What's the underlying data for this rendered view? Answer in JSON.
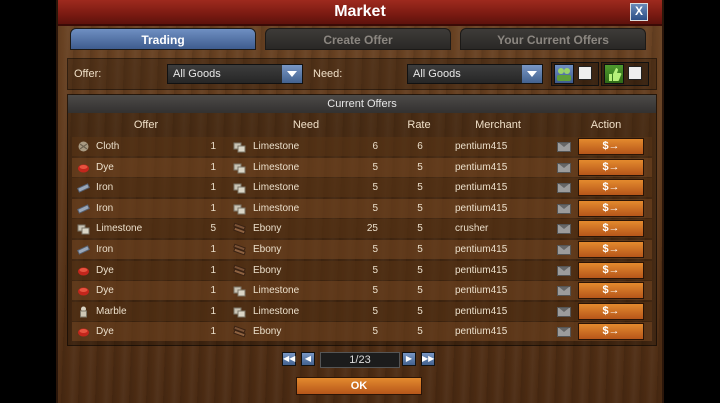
{
  "window": {
    "title": "Market",
    "close_label": "X"
  },
  "tabs": [
    {
      "label": "Trading",
      "active": true
    },
    {
      "label": "Create Offer",
      "active": false
    },
    {
      "label": "Your Current Offers",
      "active": false
    }
  ],
  "filters": {
    "offer_label": "Offer:",
    "offer_value": "All Goods",
    "need_label": "Need:",
    "need_value": "All Goods"
  },
  "offers": {
    "section_title": "Current Offers",
    "columns": [
      "Offer",
      "Need",
      "Rate",
      "Merchant",
      "Action"
    ],
    "rows": [
      {
        "offer_good": "Cloth",
        "offer_icon": "cloth-icon",
        "offer_qty": "1",
        "need_good": "Limestone",
        "need_icon": "limestone-icon",
        "need_qty": "6",
        "rate": "6",
        "merchant": "pentium415"
      },
      {
        "offer_good": "Dye",
        "offer_icon": "dye-icon",
        "offer_qty": "1",
        "need_good": "Limestone",
        "need_icon": "limestone-icon",
        "need_qty": "5",
        "rate": "5",
        "merchant": "pentium415"
      },
      {
        "offer_good": "Iron",
        "offer_icon": "iron-icon",
        "offer_qty": "1",
        "need_good": "Limestone",
        "need_icon": "limestone-icon",
        "need_qty": "5",
        "rate": "5",
        "merchant": "pentium415"
      },
      {
        "offer_good": "Iron",
        "offer_icon": "iron-icon",
        "offer_qty": "1",
        "need_good": "Limestone",
        "need_icon": "limestone-icon",
        "need_qty": "5",
        "rate": "5",
        "merchant": "pentium415"
      },
      {
        "offer_good": "Limestone",
        "offer_icon": "limestone-icon",
        "offer_qty": "5",
        "need_good": "Ebony",
        "need_icon": "ebony-icon",
        "need_qty": "25",
        "rate": "5",
        "merchant": "crusher"
      },
      {
        "offer_good": "Iron",
        "offer_icon": "iron-icon",
        "offer_qty": "1",
        "need_good": "Ebony",
        "need_icon": "ebony-icon",
        "need_qty": "5",
        "rate": "5",
        "merchant": "pentium415"
      },
      {
        "offer_good": "Dye",
        "offer_icon": "dye-icon",
        "offer_qty": "1",
        "need_good": "Ebony",
        "need_icon": "ebony-icon",
        "need_qty": "5",
        "rate": "5",
        "merchant": "pentium415"
      },
      {
        "offer_good": "Dye",
        "offer_icon": "dye-icon",
        "offer_qty": "1",
        "need_good": "Limestone",
        "need_icon": "limestone-icon",
        "need_qty": "5",
        "rate": "5",
        "merchant": "pentium415"
      },
      {
        "offer_good": "Marble",
        "offer_icon": "marble-icon",
        "offer_qty": "1",
        "need_good": "Limestone",
        "need_icon": "limestone-icon",
        "need_qty": "5",
        "rate": "5",
        "merchant": "pentium415"
      },
      {
        "offer_good": "Dye",
        "offer_icon": "dye-icon",
        "offer_qty": "1",
        "need_good": "Ebony",
        "need_icon": "ebony-icon",
        "need_qty": "5",
        "rate": "5",
        "merchant": "pentium415"
      }
    ],
    "trade_label": "$→"
  },
  "pager": {
    "page_text": "1/23"
  },
  "ok_label": "OK"
}
